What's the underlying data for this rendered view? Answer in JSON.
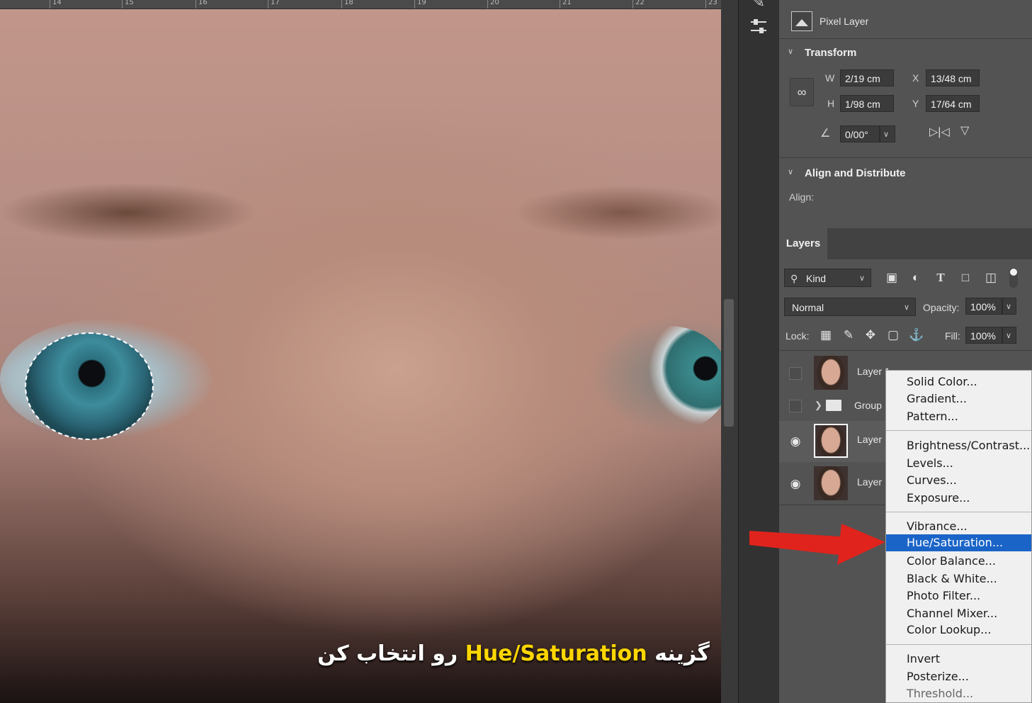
{
  "canvas": {
    "ruler_marks": [
      "14",
      "15",
      "16",
      "17",
      "18",
      "19",
      "20",
      "21",
      "22",
      "23"
    ],
    "caption_before": "گزینه",
    "caption_highlight": "Hue/Saturation",
    "caption_after": "رو انتخاب کن"
  },
  "properties": {
    "layer_kind": "Pixel Layer",
    "transform": {
      "title": "Transform",
      "w_label": "W",
      "w_value": "2/19 cm",
      "h_label": "H",
      "h_value": "1/98 cm",
      "x_label": "X",
      "x_value": "13/48 cm",
      "y_label": "Y",
      "y_value": "17/64 cm",
      "angle_value": "0/00°"
    },
    "align": {
      "title": "Align and Distribute",
      "align_label": "Align:"
    }
  },
  "layers": {
    "tab_label": "Layers",
    "filter_kind": "Kind",
    "blend_mode": "Normal",
    "opacity_label": "Opacity:",
    "opacity_value": "100%",
    "lock_label": "Lock:",
    "fill_label": "Fill:",
    "fill_value": "100%",
    "rows": [
      {
        "name": "Layer 1"
      },
      {
        "name": "Group"
      },
      {
        "name": "Layer"
      },
      {
        "name": "Layer"
      }
    ]
  },
  "menu": {
    "items_group1": [
      "Solid Color...",
      "Gradient...",
      "Pattern..."
    ],
    "items_group2": [
      "Brightness/Contrast...",
      "Levels...",
      "Curves...",
      "Exposure..."
    ],
    "items_group3": [
      "Vibrance...",
      "Hue/Saturation...",
      "Color Balance...",
      "Black & White...",
      "Photo Filter...",
      "Channel Mixer...",
      "Color Lookup..."
    ],
    "items_group4": [
      "Invert",
      "Posterize...",
      "Threshold..."
    ],
    "highlighted": "Hue/Saturation...",
    "highlight_color": "#1a64c8"
  },
  "colors": {
    "arrow": "#e0231c",
    "caption_highlight": "#ffd600"
  }
}
